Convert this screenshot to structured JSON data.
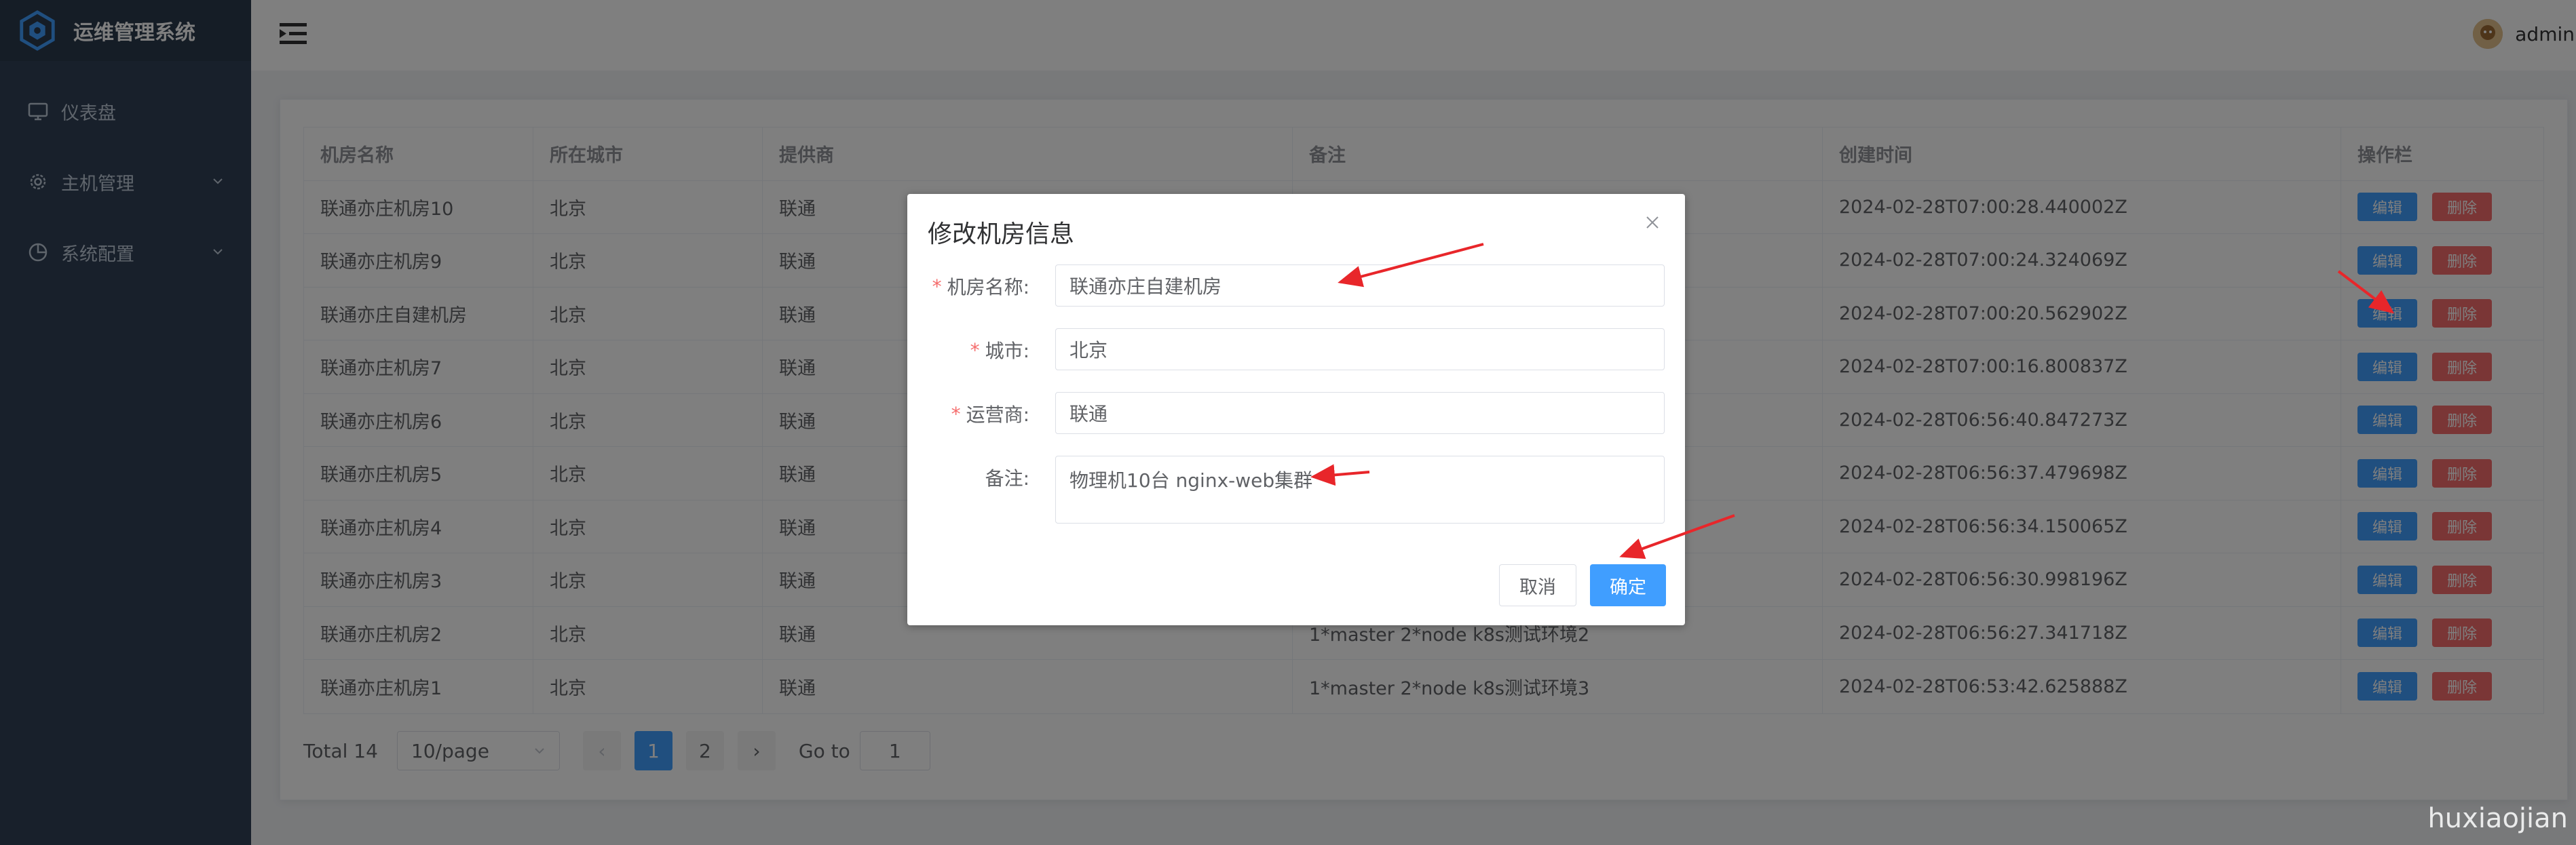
{
  "app": {
    "title": "运维管理系统"
  },
  "sidebar": {
    "items": [
      {
        "label": "仪表盘",
        "icon": "monitor-icon"
      },
      {
        "label": "主机管理",
        "icon": "gear-icon"
      },
      {
        "label": "系统配置",
        "icon": "pie-chart-icon"
      }
    ]
  },
  "header": {
    "username": "admin"
  },
  "table": {
    "columns": [
      "机房名称",
      "所在城市",
      "提供商",
      "备注",
      "创建时间",
      "操作栏"
    ],
    "rows": [
      {
        "name": "联通亦庄机房10",
        "city": "北京",
        "provider": "联通",
        "note": "",
        "created": "2024-02-28T07:00:28.440002Z"
      },
      {
        "name": "联通亦庄机房9",
        "city": "北京",
        "provider": "联通",
        "note": "",
        "created": "2024-02-28T07:00:24.324069Z"
      },
      {
        "name": "联通亦庄自建机房",
        "city": "北京",
        "provider": "联通",
        "note": "",
        "created": "2024-02-28T07:00:20.562902Z"
      },
      {
        "name": "联通亦庄机房7",
        "city": "北京",
        "provider": "联通",
        "note": "",
        "created": "2024-02-28T07:00:16.800837Z"
      },
      {
        "name": "联通亦庄机房6",
        "city": "北京",
        "provider": "联通",
        "note": "",
        "created": "2024-02-28T06:56:40.847273Z"
      },
      {
        "name": "联通亦庄机房5",
        "city": "北京",
        "provider": "联通",
        "note": "",
        "created": "2024-02-28T06:56:37.479698Z"
      },
      {
        "name": "联通亦庄机房4",
        "city": "北京",
        "provider": "联通",
        "note": "",
        "created": "2024-02-28T06:56:34.150065Z"
      },
      {
        "name": "联通亦庄机房3",
        "city": "北京",
        "provider": "联通",
        "note": "",
        "created": "2024-02-28T06:56:30.998196Z"
      },
      {
        "name": "联通亦庄机房2",
        "city": "北京",
        "provider": "联通",
        "note": "1*master 2*node k8s测试环境2",
        "created": "2024-02-28T06:56:27.341718Z"
      },
      {
        "name": "联通亦庄机房1",
        "city": "北京",
        "provider": "联通",
        "note": "1*master 2*node k8s测试环境3",
        "created": "2024-02-28T06:53:42.625888Z"
      }
    ],
    "edit_label": "编辑",
    "delete_label": "删除"
  },
  "pagination": {
    "total": "Total 14",
    "page_size": "10/page",
    "prev": "‹",
    "pages": [
      "1",
      "2"
    ],
    "current_page": "1",
    "next": "›",
    "goto_label": "Go to",
    "goto_value": "1"
  },
  "dialog": {
    "title": "修改机房信息",
    "fields": {
      "name": {
        "label": "机房名称:",
        "value": "联通亦庄自建机房",
        "required": true
      },
      "city": {
        "label": "城市:",
        "value": "北京",
        "required": true
      },
      "provider": {
        "label": "运营商:",
        "value": "联通",
        "required": true
      },
      "note": {
        "label": "备注:",
        "value": "物理机10台 nginx-web集群",
        "required": false
      }
    },
    "required_mark": "*",
    "cancel_label": "取消",
    "confirm_label": "确定"
  },
  "watermark": "huxiaojian",
  "colors": {
    "primary": "#409eff",
    "danger": "#f56c6c",
    "sidebar": "#304156",
    "annotation": "#e8262a"
  }
}
